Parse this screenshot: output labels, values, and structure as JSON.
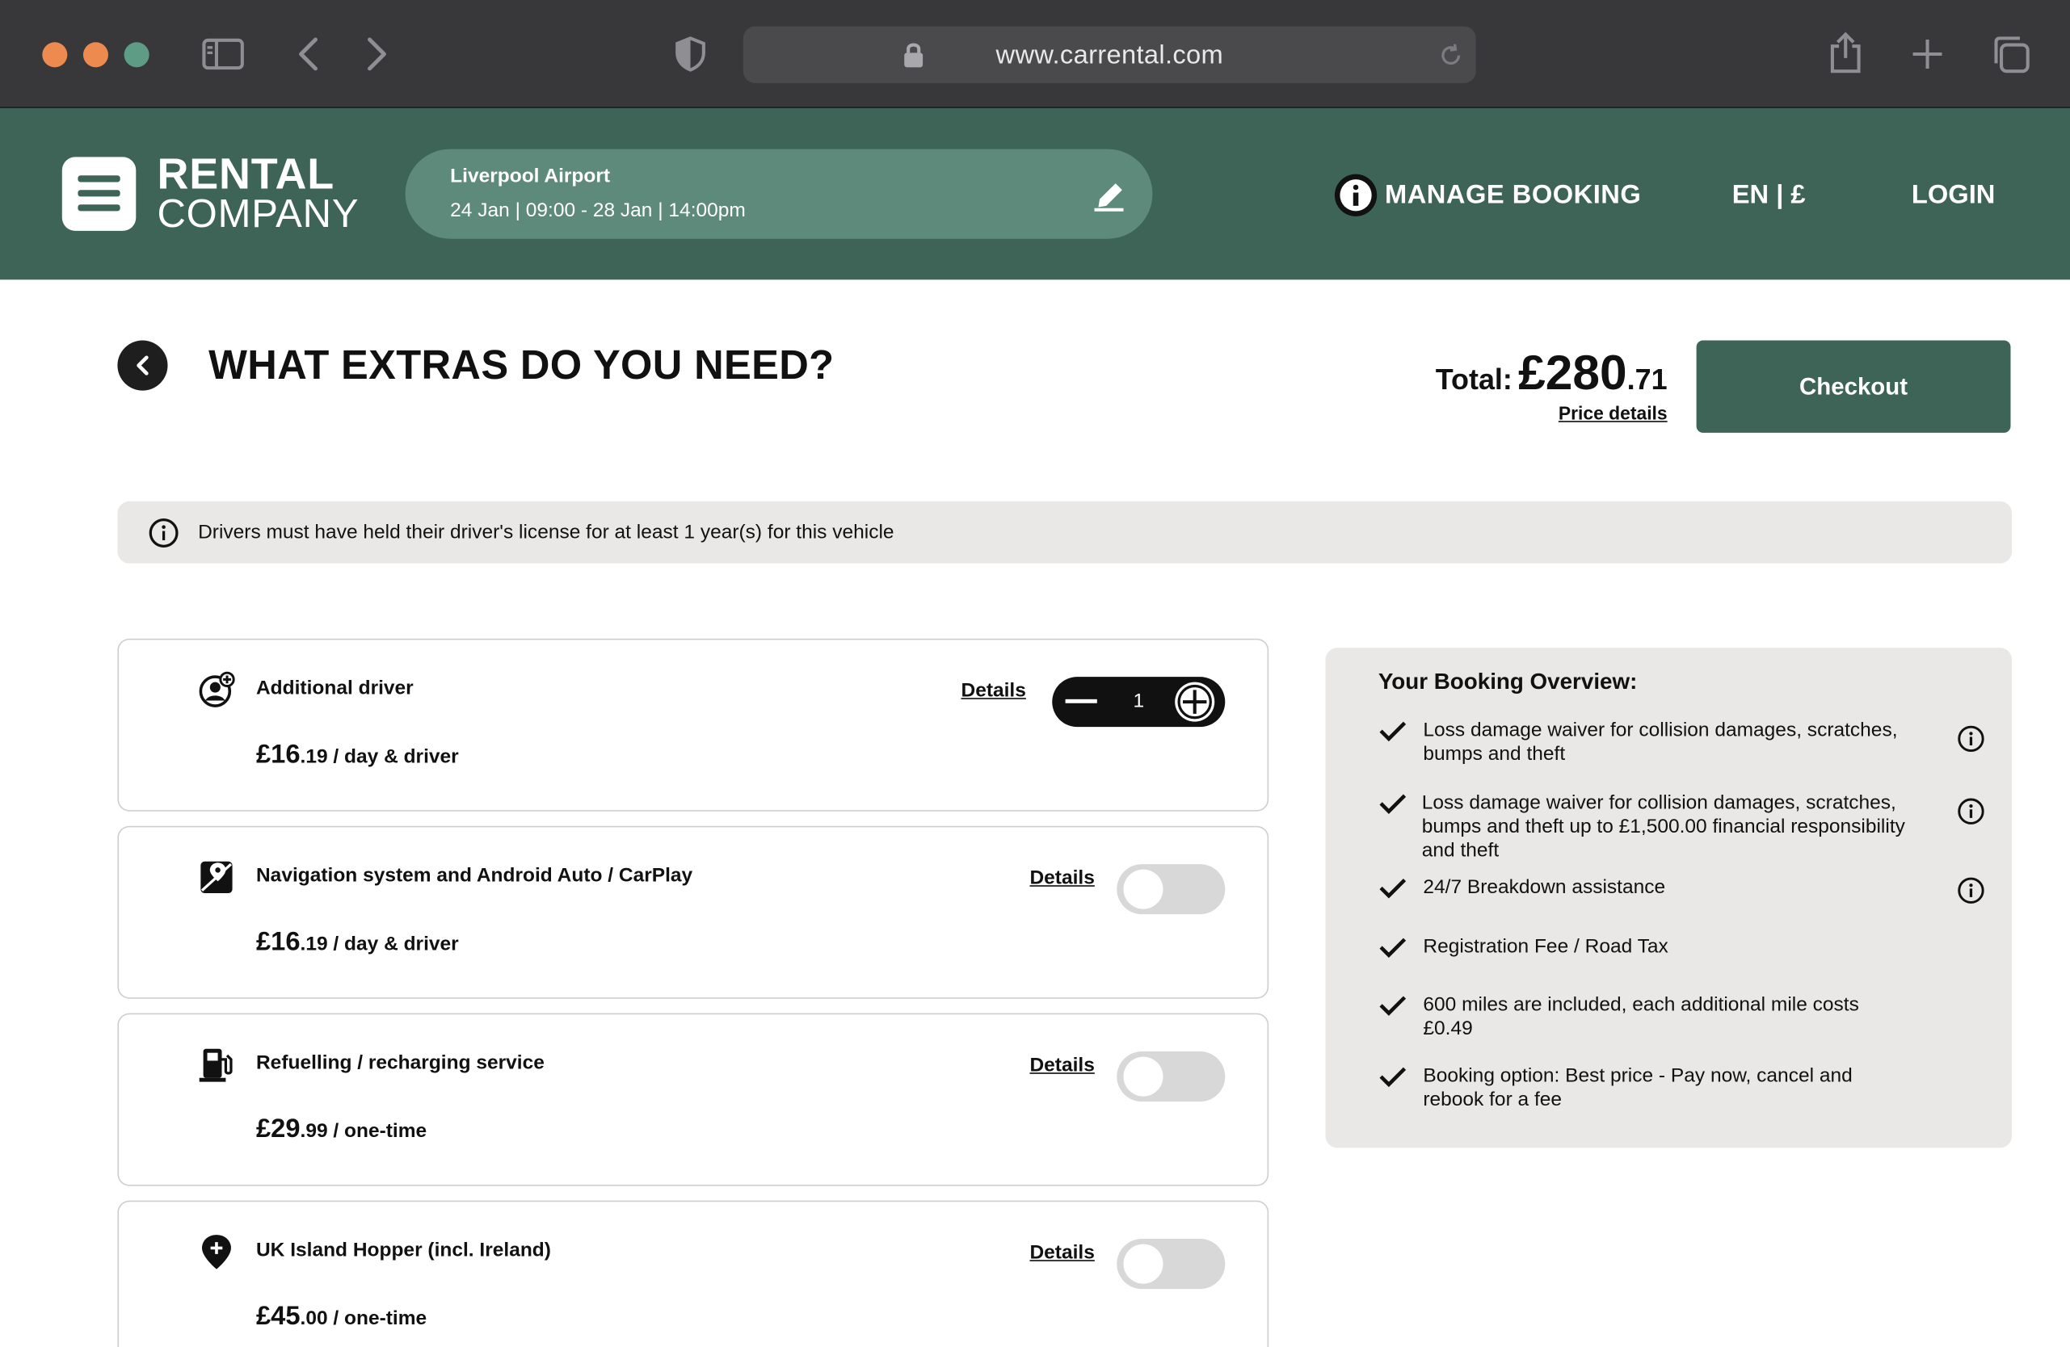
{
  "browser": {
    "url": "www.carrental.com"
  },
  "header": {
    "logo_line1": "RENTAL",
    "logo_line2": "COMPANY",
    "search": {
      "location": "Liverpool Airport",
      "dates": "24 Jan | 09:00 - 28 Jan | 14:00pm"
    },
    "nav": {
      "manage_booking": "MANAGE BOOKING",
      "lang_currency": "EN | £",
      "login": "LOGIN"
    }
  },
  "page": {
    "title": "WHAT EXTRAS DO YOU NEED?",
    "total_label": "Total:",
    "total_main": "£280",
    "total_cents": ".71",
    "price_details": "Price details",
    "checkout": "Checkout"
  },
  "notice": "Drivers must have held their driver's license for at least 1 year(s) for this vehicle",
  "extras": [
    {
      "icon": "add-person-icon",
      "title": "Additional driver",
      "price_main": "£16",
      "price_cents": ".19",
      "price_unit": " / day & driver",
      "details": "Details",
      "control": "stepper",
      "quantity": "1"
    },
    {
      "icon": "navigation-map-icon",
      "title": "Navigation system and Android Auto / CarPlay",
      "price_main": "£16",
      "price_cents": ".19",
      "price_unit": " / day & driver",
      "details": "Details",
      "control": "toggle",
      "selected": false
    },
    {
      "icon": "fuel-pump-icon",
      "title": "Refuelling / recharging service",
      "price_main": "£29",
      "price_cents": ".99",
      "price_unit": " / one-time",
      "details": "Details",
      "control": "toggle",
      "selected": false
    },
    {
      "icon": "location-plus-icon",
      "title": "UK Island Hopper (incl. Ireland)",
      "price_main": "£45",
      "price_cents": ".00",
      "price_unit": " / one-time",
      "details": "Details",
      "control": "toggle",
      "selected": false
    }
  ],
  "overview": {
    "title": "Your Booking Overview:",
    "items": [
      {
        "text": "Loss damage waiver for collision damages, scratches, bumps and theft",
        "has_info": true
      },
      {
        "text": "Loss damage waiver for collision damages, scratches, bumps and theft up to £1,500.00 financial responsibility and theft",
        "has_info": true
      },
      {
        "text": "24/7 Breakdown assistance",
        "has_info": true
      },
      {
        "text": "Registration Fee / Road Tax",
        "has_info": false
      },
      {
        "text": "600 miles are included, each additional mile costs £0.49",
        "has_info": false
      },
      {
        "text": "Booking option: Best price - Pay now, cancel and rebook for a fee",
        "has_info": false
      }
    ]
  },
  "colors": {
    "brand_green": "#3d6457",
    "pill_green": "#5e8a7b",
    "panel_gray": "#e9e8e6"
  }
}
